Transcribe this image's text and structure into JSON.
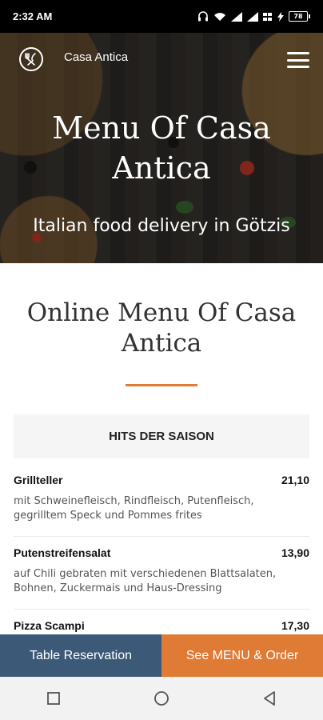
{
  "status": {
    "time": "2:32 AM",
    "battery": "78"
  },
  "header": {
    "brand": "Casa Antica"
  },
  "hero": {
    "title": "Menu Of Casa Antica",
    "subtitle": "Italian food delivery in Götzis"
  },
  "section": {
    "title": "Online Menu Of Casa Antica"
  },
  "category": {
    "label": "HITS DER SAISON"
  },
  "items": [
    {
      "name": "Grillteller",
      "price": "21,10",
      "description": "mit Schweinefleisch, Rindfleisch, Putenfleisch, gegrilltem Speck und Pommes frites"
    },
    {
      "name": "Putenstreifensalat",
      "price": "13,90",
      "description": "auf Chili gebraten mit verschiedenen Blattsalaten, Bohnen, Zuckermais und Haus-Dressing"
    },
    {
      "name": "Pizza Scampi",
      "price": "17,30",
      "description": ""
    }
  ],
  "buttons": {
    "reservation": "Table Reservation",
    "order": "See MENU & Order"
  },
  "colors": {
    "accent": "#e07b36",
    "reservation": "#3c5a77"
  },
  "icons": [
    "headphones-icon",
    "wifi-icon",
    "signal-icon",
    "lte-icon",
    "charging-icon",
    "battery-icon",
    "restaurant-logo-icon",
    "hamburger-menu-icon",
    "nav-recents-icon",
    "nav-home-icon",
    "nav-back-icon"
  ]
}
